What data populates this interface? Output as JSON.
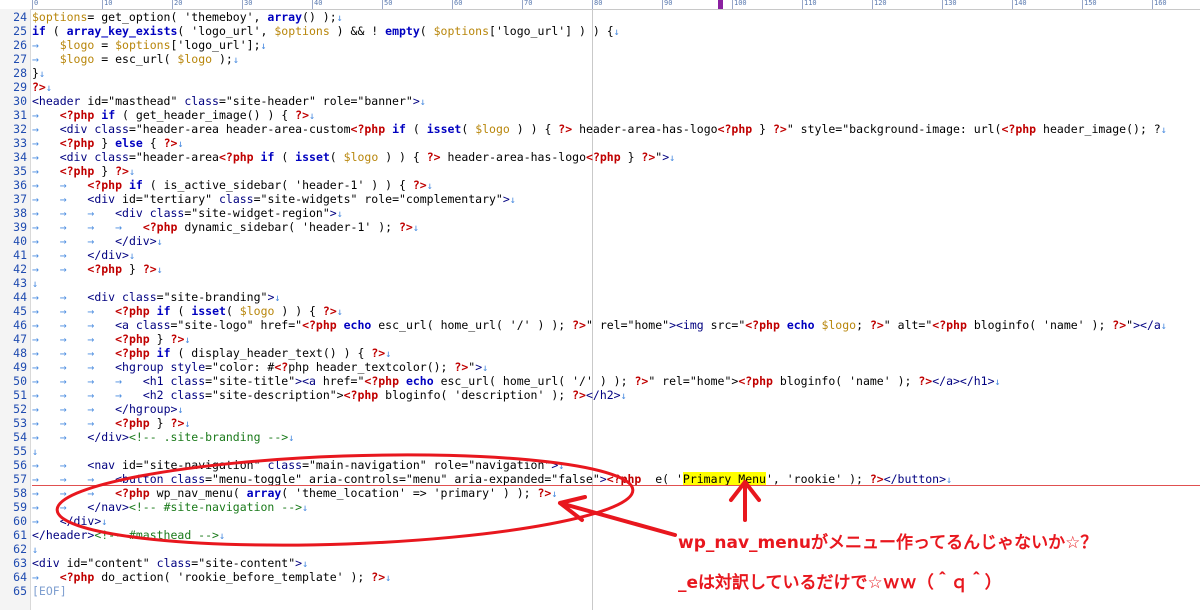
{
  "ruler": {
    "labels": [
      "0",
      "10",
      "20",
      "30",
      "40",
      "50",
      "60",
      "70",
      "80",
      "90",
      "100",
      "110",
      "120",
      "130",
      "140",
      "150",
      "160"
    ]
  },
  "editor": {
    "lines": [
      {
        "n": "24",
        "indent": 0,
        "segs": [
          [
            "var",
            "$options"
          ],
          [
            "",
            "= get_option( 'themeboy', "
          ],
          [
            "kw",
            "array"
          ],
          [
            "",
            "() );"
          ]
        ]
      },
      {
        "n": "25",
        "indent": 0,
        "segs": [
          [
            "kw",
            "if"
          ],
          [
            "",
            " ( "
          ],
          [
            "kw",
            "array_key_exists"
          ],
          [
            "",
            "( 'logo_url', "
          ],
          [
            "var",
            "$options"
          ],
          [
            "",
            " ) && ! "
          ],
          [
            "kw",
            "empty"
          ],
          [
            "",
            "( "
          ],
          [
            "var",
            "$options"
          ],
          [
            "",
            "['logo_url'] ) ) {"
          ]
        ]
      },
      {
        "n": "26",
        "indent": 1,
        "segs": [
          [
            "var",
            "$logo"
          ],
          [
            "",
            " = "
          ],
          [
            "var",
            "$options"
          ],
          [
            "",
            "['logo_url'];"
          ]
        ]
      },
      {
        "n": "27",
        "indent": 1,
        "segs": [
          [
            "var",
            "$logo"
          ],
          [
            "",
            " = esc_url( "
          ],
          [
            "var",
            "$logo"
          ],
          [
            "",
            " );"
          ]
        ]
      },
      {
        "n": "28",
        "indent": 0,
        "segs": [
          [
            "",
            "}"
          ]
        ]
      },
      {
        "n": "29",
        "indent": 0,
        "segs": [
          [
            "ph",
            "?>"
          ]
        ]
      },
      {
        "n": "30",
        "indent": 0,
        "segs": [
          [
            "tag",
            "<header"
          ],
          [
            "",
            " id=\"masthead\" "
          ],
          [
            "tag",
            "class"
          ],
          [
            "",
            "=\"site-header\" role=\"banner\""
          ],
          [
            "tag",
            ">"
          ]
        ]
      },
      {
        "n": "31",
        "indent": 1,
        "segs": [
          [
            "ph",
            "<?php"
          ],
          [
            "",
            " "
          ],
          [
            "kw",
            "if"
          ],
          [
            "",
            " ( get_header_image() ) { "
          ],
          [
            "ph",
            "?>"
          ]
        ]
      },
      {
        "n": "32",
        "indent": 1,
        "segs": [
          [
            "tag",
            "<div class"
          ],
          [
            "",
            "=\"header-area header-area-custom"
          ],
          [
            "ph",
            "<?php"
          ],
          [
            "",
            " "
          ],
          [
            "kw",
            "if"
          ],
          [
            "",
            " ( "
          ],
          [
            "kw",
            "isset"
          ],
          [
            "",
            "( "
          ],
          [
            "var",
            "$logo"
          ],
          [
            "",
            " ) ) { "
          ],
          [
            "ph",
            "?>"
          ],
          [
            "",
            " header-area-has-logo"
          ],
          [
            "ph",
            "<?php"
          ],
          [
            "",
            " } "
          ],
          [
            "ph",
            "?>"
          ],
          [
            "",
            "\" style=\"background-image: url("
          ],
          [
            "ph",
            "<?php"
          ],
          [
            "",
            " header_image(); ?"
          ]
        ]
      },
      {
        "n": "33",
        "indent": 1,
        "segs": [
          [
            "ph",
            "<?php"
          ],
          [
            "",
            " } "
          ],
          [
            "kw",
            "else"
          ],
          [
            "",
            " { "
          ],
          [
            "ph",
            "?>"
          ]
        ]
      },
      {
        "n": "34",
        "indent": 1,
        "segs": [
          [
            "tag",
            "<div class"
          ],
          [
            "",
            "=\"header-area"
          ],
          [
            "ph",
            "<?php"
          ],
          [
            "",
            " "
          ],
          [
            "kw",
            "if"
          ],
          [
            "",
            " ( "
          ],
          [
            "kw",
            "isset"
          ],
          [
            "",
            "( "
          ],
          [
            "var",
            "$logo"
          ],
          [
            "",
            " ) ) { "
          ],
          [
            "ph",
            "?>"
          ],
          [
            "",
            " header-area-has-logo"
          ],
          [
            "ph",
            "<?php"
          ],
          [
            "",
            " } "
          ],
          [
            "ph",
            "?>"
          ],
          [
            "",
            "\""
          ],
          [
            "tag",
            ">"
          ]
        ]
      },
      {
        "n": "35",
        "indent": 1,
        "segs": [
          [
            "ph",
            "<?php"
          ],
          [
            "",
            " } "
          ],
          [
            "ph",
            "?>"
          ]
        ]
      },
      {
        "n": "36",
        "indent": 2,
        "segs": [
          [
            "ph",
            "<?php"
          ],
          [
            "",
            " "
          ],
          [
            "kw",
            "if"
          ],
          [
            "",
            " ( is_active_sidebar( 'header-1' ) ) { "
          ],
          [
            "ph",
            "?>"
          ]
        ]
      },
      {
        "n": "37",
        "indent": 2,
        "segs": [
          [
            "tag",
            "<div"
          ],
          [
            "",
            " id=\"tertiary\" "
          ],
          [
            "tag",
            "class"
          ],
          [
            "",
            "=\"site-widgets\" role=\"complementary\""
          ],
          [
            "tag",
            ">"
          ]
        ]
      },
      {
        "n": "38",
        "indent": 3,
        "segs": [
          [
            "tag",
            "<div class"
          ],
          [
            "",
            "=\"site-widget-region\""
          ],
          [
            "tag",
            ">"
          ]
        ]
      },
      {
        "n": "39",
        "indent": 4,
        "segs": [
          [
            "ph",
            "<?php"
          ],
          [
            "",
            " dynamic_sidebar( 'header-1' ); "
          ],
          [
            "ph",
            "?>"
          ]
        ]
      },
      {
        "n": "40",
        "indent": 3,
        "segs": [
          [
            "tag",
            "</div>"
          ]
        ]
      },
      {
        "n": "41",
        "indent": 2,
        "segs": [
          [
            "tag",
            "</div>"
          ]
        ]
      },
      {
        "n": "42",
        "indent": 2,
        "segs": [
          [
            "ph",
            "<?php"
          ],
          [
            "",
            " } "
          ],
          [
            "ph",
            "?>"
          ]
        ]
      },
      {
        "n": "43",
        "indent": 0,
        "segs": []
      },
      {
        "n": "44",
        "indent": 2,
        "segs": [
          [
            "tag",
            "<div class"
          ],
          [
            "",
            "=\"site-branding\""
          ],
          [
            "tag",
            ">"
          ]
        ]
      },
      {
        "n": "45",
        "indent": 3,
        "segs": [
          [
            "ph",
            "<?php"
          ],
          [
            "",
            " "
          ],
          [
            "kw",
            "if"
          ],
          [
            "",
            " ( "
          ],
          [
            "kw",
            "isset"
          ],
          [
            "",
            "( "
          ],
          [
            "var",
            "$logo"
          ],
          [
            "",
            " ) ) { "
          ],
          [
            "ph",
            "?>"
          ]
        ]
      },
      {
        "n": "46",
        "indent": 3,
        "segs": [
          [
            "tag",
            "<a class"
          ],
          [
            "",
            "=\"site-logo\" href=\""
          ],
          [
            "ph",
            "<?php"
          ],
          [
            "",
            " "
          ],
          [
            "kw",
            "echo"
          ],
          [
            "",
            " esc_url( home_url( '/' ) ); "
          ],
          [
            "ph",
            "?>"
          ],
          [
            "",
            "\" rel=\"home\""
          ],
          [
            "tag",
            "><img"
          ],
          [
            "",
            " src=\""
          ],
          [
            "ph",
            "<?php"
          ],
          [
            "",
            " "
          ],
          [
            "kw",
            "echo"
          ],
          [
            "",
            " "
          ],
          [
            "var",
            "$logo"
          ],
          [
            "",
            "; "
          ],
          [
            "ph",
            "?>"
          ],
          [
            "",
            "\" alt=\""
          ],
          [
            "ph",
            "<?php"
          ],
          [
            "",
            " bloginfo( 'name' ); "
          ],
          [
            "ph",
            "?>"
          ],
          [
            "",
            "\""
          ],
          [
            "tag",
            "></a"
          ]
        ]
      },
      {
        "n": "47",
        "indent": 3,
        "segs": [
          [
            "ph",
            "<?php"
          ],
          [
            "",
            " } "
          ],
          [
            "ph",
            "?>"
          ]
        ]
      },
      {
        "n": "48",
        "indent": 3,
        "segs": [
          [
            "ph",
            "<?php"
          ],
          [
            "",
            " "
          ],
          [
            "kw",
            "if"
          ],
          [
            "",
            " ( display_header_text() ) { "
          ],
          [
            "ph",
            "?>"
          ]
        ]
      },
      {
        "n": "49",
        "indent": 3,
        "segs": [
          [
            "tag",
            "<hgroup style"
          ],
          [
            "",
            "=\"color: #"
          ],
          [
            "ph",
            "<?"
          ],
          [
            "",
            "php header_textcolor(); "
          ],
          [
            "ph",
            "?>"
          ],
          [
            "",
            "\""
          ],
          [
            "tag",
            ">"
          ]
        ]
      },
      {
        "n": "50",
        "indent": 4,
        "segs": [
          [
            "tag",
            "<h1 class"
          ],
          [
            "",
            "=\"site-title\""
          ],
          [
            "tag",
            "><a"
          ],
          [
            "",
            " href=\""
          ],
          [
            "ph",
            "<?php"
          ],
          [
            "",
            " "
          ],
          [
            "kw",
            "echo"
          ],
          [
            "",
            " esc_url( home_url( '/' ) ); "
          ],
          [
            "ph",
            "?>"
          ],
          [
            "",
            "\" rel=\"home\">"
          ],
          [
            "ph",
            "<?php"
          ],
          [
            "",
            " bloginfo( 'name' ); "
          ],
          [
            "ph",
            "?>"
          ],
          [
            "tag",
            "</a></h1>"
          ]
        ]
      },
      {
        "n": "51",
        "indent": 4,
        "segs": [
          [
            "tag",
            "<h2 class"
          ],
          [
            "",
            "=\"site-description\">"
          ],
          [
            "ph",
            "<?php"
          ],
          [
            "",
            " bloginfo( 'description' ); "
          ],
          [
            "ph",
            "?>"
          ],
          [
            "tag",
            "</h2>"
          ]
        ]
      },
      {
        "n": "52",
        "indent": 3,
        "segs": [
          [
            "tag",
            "</hgroup>"
          ]
        ]
      },
      {
        "n": "53",
        "indent": 3,
        "segs": [
          [
            "ph",
            "<?php"
          ],
          [
            "",
            " } "
          ],
          [
            "ph",
            "?>"
          ]
        ]
      },
      {
        "n": "54",
        "indent": 2,
        "segs": [
          [
            "tag",
            "</div>"
          ],
          [
            "cmt",
            "<!-- .site-branding -->"
          ]
        ]
      },
      {
        "n": "55",
        "indent": 0,
        "segs": []
      },
      {
        "n": "56",
        "indent": 2,
        "segs": [
          [
            "tag",
            "<nav"
          ],
          [
            "",
            " id=\"site-navigation\" "
          ],
          [
            "tag",
            "class"
          ],
          [
            "",
            "=\"main-navigation\" role=\"navigation\""
          ],
          [
            "tag",
            ">"
          ]
        ]
      },
      {
        "n": "57",
        "indent": 3,
        "segs": [
          [
            "tag",
            "<button class"
          ],
          [
            "",
            "=\"menu-toggle\" aria-controls=\"menu\" aria-expanded=\"false\""
          ],
          [
            "tag",
            ">"
          ],
          [
            "ph",
            "<?php"
          ],
          [
            "",
            " _e( '"
          ],
          [
            "hl",
            "Primary Menu"
          ],
          [
            "",
            "', 'rookie' ); "
          ],
          [
            "ph",
            "?>"
          ],
          [
            "tag",
            "</button>"
          ]
        ]
      },
      {
        "n": "58",
        "indent": 3,
        "segs": [
          [
            "ph",
            "<?php"
          ],
          [
            "",
            " wp_nav_menu( "
          ],
          [
            "kw",
            "array"
          ],
          [
            "",
            "( 'theme_location' => 'primary' ) ); "
          ],
          [
            "ph",
            "?>"
          ]
        ]
      },
      {
        "n": "59",
        "indent": 2,
        "segs": [
          [
            "tag",
            "</nav>"
          ],
          [
            "cmt",
            "<!-- #site-navigation -->"
          ]
        ]
      },
      {
        "n": "60",
        "indent": 1,
        "segs": [
          [
            "tag",
            "</div>"
          ]
        ]
      },
      {
        "n": "61",
        "indent": 0,
        "segs": [
          [
            "tag",
            "</header>"
          ],
          [
            "cmt",
            "<!-- #masthead -->"
          ]
        ]
      },
      {
        "n": "62",
        "indent": 0,
        "segs": []
      },
      {
        "n": "63",
        "indent": 0,
        "segs": [
          [
            "tag",
            "<div"
          ],
          [
            "",
            " id=\"content\" "
          ],
          [
            "tag",
            "class"
          ],
          [
            "",
            "=\"site-content\""
          ],
          [
            "tag",
            ">"
          ]
        ]
      },
      {
        "n": "64",
        "indent": 1,
        "segs": [
          [
            "ph",
            "<?php"
          ],
          [
            "",
            " do_action( 'rookie_before_template' ); "
          ],
          [
            "ph",
            "?>"
          ]
        ]
      },
      {
        "n": "65",
        "indent": 0,
        "segs": [
          [
            "eof",
            "[EOF]"
          ]
        ]
      }
    ]
  },
  "annotation": {
    "line1": "wp_nav_menuがメニュー作ってるんじゃないか☆？",
    "line2": "_eは対訳しているだけで☆ｗｗ（＾ｑ＾）"
  },
  "colors": {
    "annotation_red": "#e8171e",
    "php_red": "#c00000",
    "keyword_blue": "#0000c0",
    "variable_gold": "#b8860b",
    "highlight_yellow": "#ffff00"
  }
}
